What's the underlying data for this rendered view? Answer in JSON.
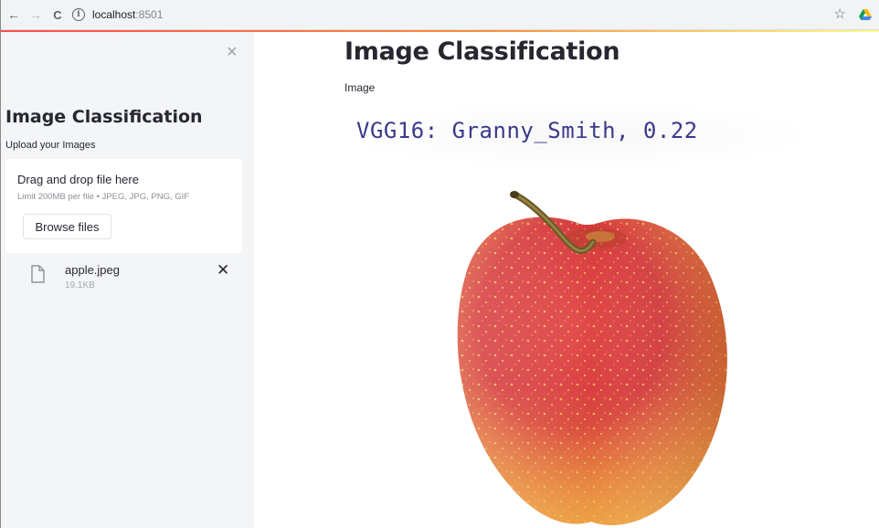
{
  "browser": {
    "url_host": "localhost",
    "url_port": ":8501",
    "back_glyph": "←",
    "forward_glyph": "→",
    "reload_glyph": "C",
    "info_glyph": "i",
    "star_glyph": "☆"
  },
  "sidebar": {
    "close_glyph": "×",
    "title": "Image Classification",
    "uploader_label": "Upload your Images",
    "dropzone": {
      "title": "Drag and drop file here",
      "limits": "Limit 200MB per file • JPEG, JPG, PNG, GIF",
      "browse_label": "Browse files"
    },
    "files": [
      {
        "name": "apple.jpeg",
        "size": "19.1KB",
        "remove_glyph": "✕"
      }
    ]
  },
  "main": {
    "title": "Image Classification",
    "image_caption": "Image",
    "prediction_text": "VGG16: Granny_Smith, 0.22"
  },
  "colors": {
    "text": "#262730",
    "sidebar_bg": "#f4f5f7",
    "prediction_text": "#3a3a8a",
    "apple_red": "#c8303a",
    "apple_yellow": "#e8a93a"
  }
}
